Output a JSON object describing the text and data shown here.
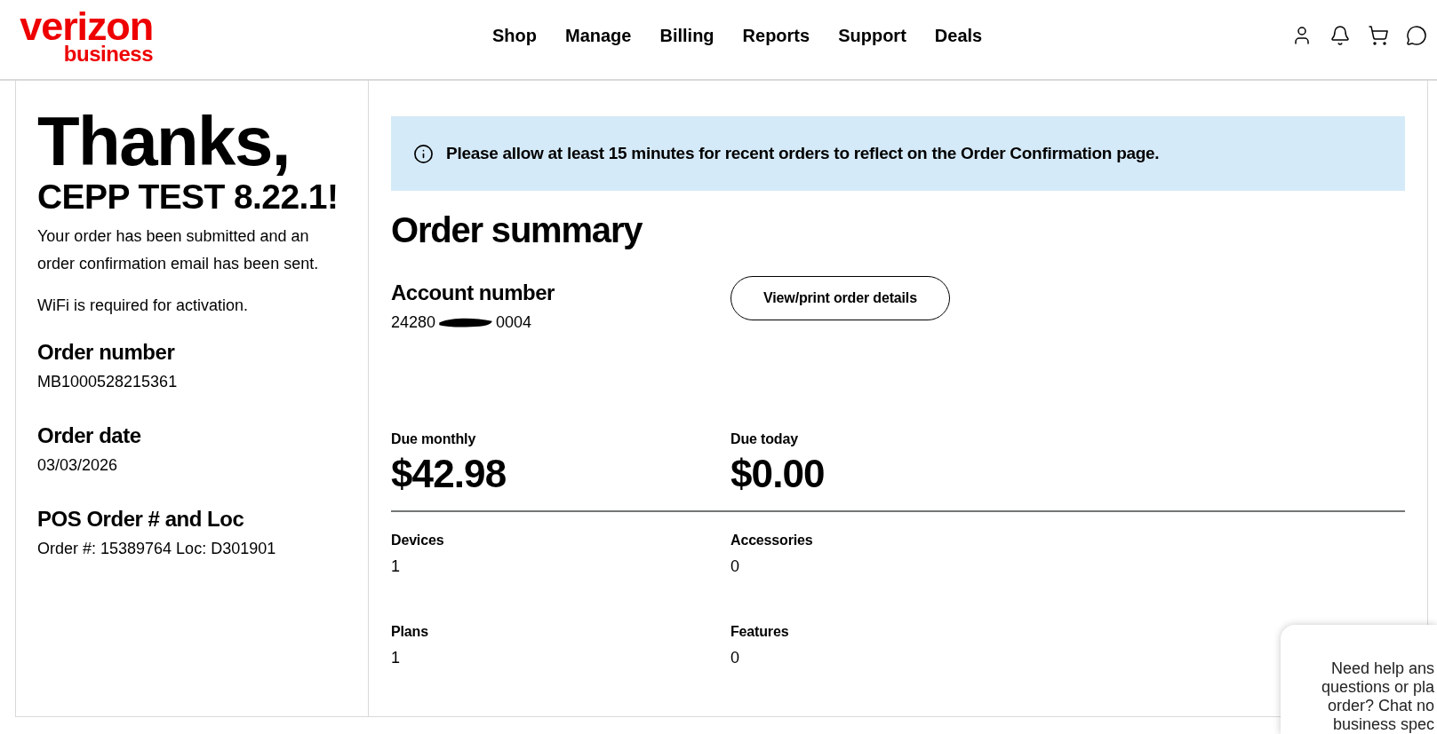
{
  "logo": {
    "wordmark": "verizon",
    "tagline": "business"
  },
  "nav": [
    "Shop",
    "Manage",
    "Billing",
    "Reports",
    "Support",
    "Deals"
  ],
  "confirmation": {
    "greeting": "Thanks,",
    "name": "CEPP TEST 8.22.1!",
    "messages": [
      "Your order has been submitted and an order confirmation email has been sent.",
      "WiFi is required for activation."
    ],
    "details": [
      {
        "label": "Order number",
        "value": "MB1000528215361"
      },
      {
        "label": "Order date",
        "value": "03/03/2026"
      },
      {
        "label": "POS Order # and Loc",
        "value": "Order #: 15389764 Loc: D301901"
      }
    ]
  },
  "notice": {
    "text": "Please allow at least 15 minutes for recent orders to reflect on the Order Confirmation page."
  },
  "order_summary": {
    "title": "Order summary",
    "account": {
      "label": "Account number",
      "visible_parts": [
        "24280",
        "0004"
      ],
      "redacted": true
    },
    "action_button": "View/print order details",
    "totals": [
      {
        "label": "Due monthly",
        "amount": "$42.98"
      },
      {
        "label": "Due today",
        "amount": "$0.00"
      }
    ],
    "counts": [
      {
        "label": "Devices",
        "value": "1"
      },
      {
        "label": "Accessories",
        "value": "0"
      },
      {
        "label": "Plans",
        "value": "1"
      },
      {
        "label": "Features",
        "value": "0"
      }
    ]
  },
  "chat_prompt": {
    "lines": [
      "Need help ans",
      "questions or pla",
      "order? Chat no",
      "business spec"
    ]
  }
}
